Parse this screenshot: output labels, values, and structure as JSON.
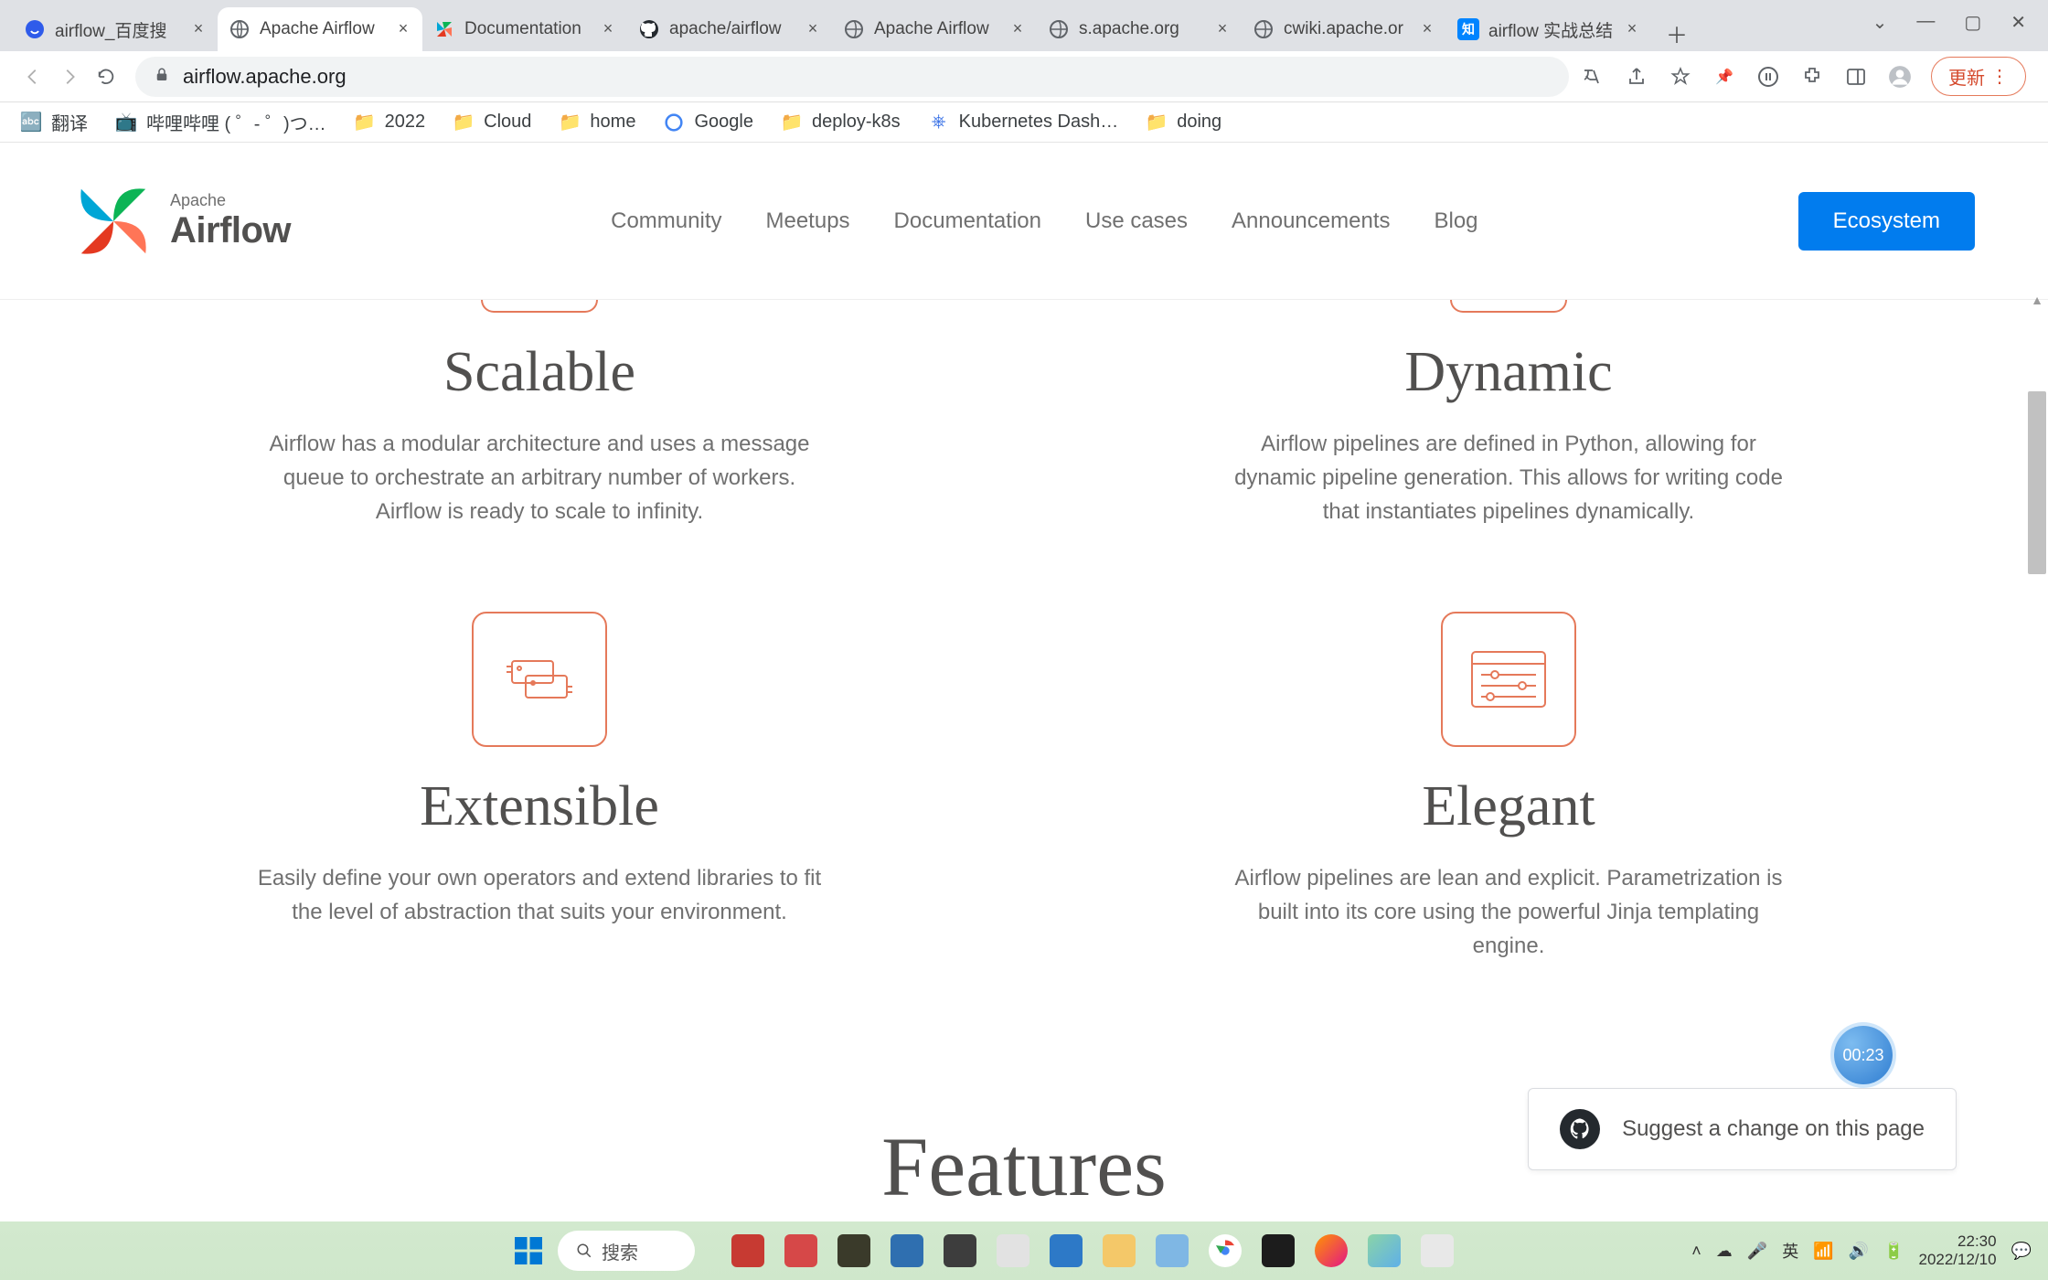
{
  "browser": {
    "tabs": [
      {
        "title": "airflow_百度搜",
        "favicon": "baidu"
      },
      {
        "title": "Apache Airflow",
        "favicon": "globe",
        "active": true
      },
      {
        "title": "Documentation",
        "favicon": "pinwheel"
      },
      {
        "title": "apache/airflow",
        "favicon": "github"
      },
      {
        "title": "Apache Airflow",
        "favicon": "globe"
      },
      {
        "title": "s.apache.org",
        "favicon": "globe"
      },
      {
        "title": "cwiki.apache.or",
        "favicon": "globe"
      },
      {
        "title": "airflow 实战总结",
        "favicon": "zhihu"
      }
    ],
    "url": "airflow.apache.org",
    "update_label": "更新",
    "bookmarks": [
      {
        "label": "翻译",
        "icon": "translate"
      },
      {
        "label": "哔哩哔哩 ( ゜- ゜)つ…",
        "icon": "bilibili"
      },
      {
        "label": "2022",
        "icon": "folder"
      },
      {
        "label": "Cloud",
        "icon": "folder"
      },
      {
        "label": "home",
        "icon": "folder"
      },
      {
        "label": "Google",
        "icon": "google"
      },
      {
        "label": "deploy-k8s",
        "icon": "folder"
      },
      {
        "label": "Kubernetes Dash…",
        "icon": "k8s"
      },
      {
        "label": "doing",
        "icon": "folder"
      }
    ]
  },
  "site": {
    "brand_small": "Apache",
    "brand_big": "Airflow",
    "nav": [
      "Community",
      "Meetups",
      "Documentation",
      "Use cases",
      "Announcements",
      "Blog"
    ],
    "ecosystem_label": "Ecosystem",
    "features": [
      {
        "title": "Scalable",
        "body": "Airflow has a modular architecture and uses a message queue to orchestrate an arbitrary number of workers. Airflow is ready to scale to infinity."
      },
      {
        "title": "Dynamic",
        "body": "Airflow pipelines are defined in Python, allowing for dynamic pipeline generation. This allows for writing code that instantiates pipelines dynamically."
      },
      {
        "title": "Extensible",
        "body": "Easily define your own operators and extend libraries to fit the level of abstraction that suits your environment."
      },
      {
        "title": "Elegant",
        "body": "Airflow pipelines are lean and explicit. Parametrization is built into its core using the powerful Jinja templating engine."
      }
    ],
    "next_section": "Features",
    "suggest_label": "Suggest a change on this page",
    "timer": "00:23"
  },
  "taskbar": {
    "search_placeholder": "搜索",
    "tray": {
      "ime": "英",
      "time": "22:30",
      "date": "2022/12/10"
    }
  }
}
